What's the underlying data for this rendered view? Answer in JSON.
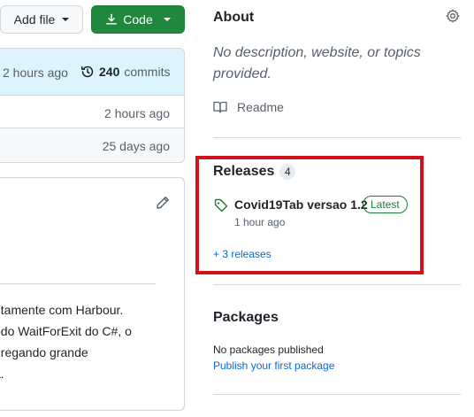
{
  "toolbar": {
    "add_file_label": "Add file",
    "code_label": "Code"
  },
  "file_list": {
    "latest_commit_time": "2 hours ago",
    "commit_count": "240",
    "commit_label": "commits",
    "rows": [
      {
        "time": "2 hours ago"
      },
      {
        "time": "25 days ago"
      }
    ]
  },
  "readme": {
    "lines": [
      "ntamente com Harbour.",
      "odo WaitForExit do C#, o",
      "gregando grande",
      "a."
    ]
  },
  "about": {
    "title": "About",
    "description_line1": "No description, website, or topics",
    "description_line2": "provided.",
    "readme_link": "Readme"
  },
  "releases": {
    "title": "Releases",
    "count": "4",
    "latest_name": "Covid19Tab versao 1.2",
    "latest_badge": "Latest",
    "latest_time": "1 hour ago",
    "more_link": "+ 3 releases"
  },
  "packages": {
    "title": "Packages",
    "none_text": "No packages published",
    "publish_link": "Publish your first package"
  },
  "colors": {
    "highlight": "#d0121b",
    "code_button": "#1f883d",
    "link": "#0969da"
  }
}
